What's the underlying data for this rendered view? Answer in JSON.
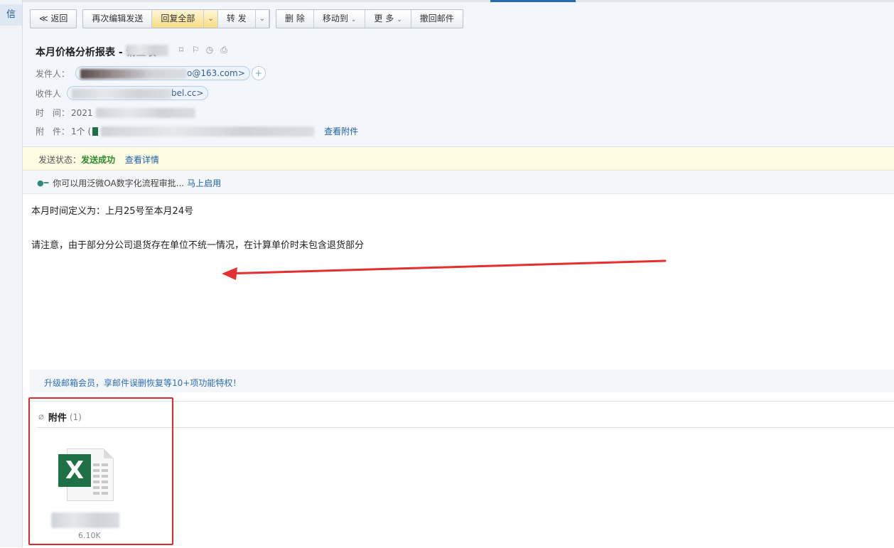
{
  "rail": {
    "tab_label": "信"
  },
  "toolbar": {
    "back_label": "≪ 返回",
    "reedit_label": "再次编辑发送",
    "reply_all_label": "回复全部",
    "forward_label": "转 发",
    "delete_label": "删 除",
    "move_label": "移动到",
    "more_label": "更 多",
    "recall_label": "撤回邮件"
  },
  "header": {
    "subject": "本月价格分析报表 - 请查收",
    "from_label": "发件人：",
    "from_tail": "o@163.com>",
    "to_label": "收件人",
    "to_tail": "bel.cc>",
    "time_label": "时　间：",
    "time_value": "2021",
    "attach_label": "附　件：",
    "attach_count": "1个 (",
    "view_attach_link": "查看附件"
  },
  "status": {
    "label": "发送状态：",
    "value": "发送成功",
    "detail_link": "查看详情"
  },
  "promo": {
    "text": "你可以用泛微OA数字化流程审批...",
    "link": "马上启用"
  },
  "body": {
    "line1": "本月时间定义为：上月25号至本月24号",
    "line2": "请注意，由于部分分公司退货存在单位不统一情况，在计算单价时未包含退货部分"
  },
  "vip": {
    "text": "升级邮箱会员，享邮件误删恢复等10+项功能特权！"
  },
  "attachments": {
    "title": "附件",
    "count": "(1)",
    "file_size": "6.10K"
  },
  "colors": {
    "accent": "#1d5fa8",
    "success": "#2f8a2f",
    "highlight": "#e02b2b",
    "excel": "#1e7145"
  }
}
